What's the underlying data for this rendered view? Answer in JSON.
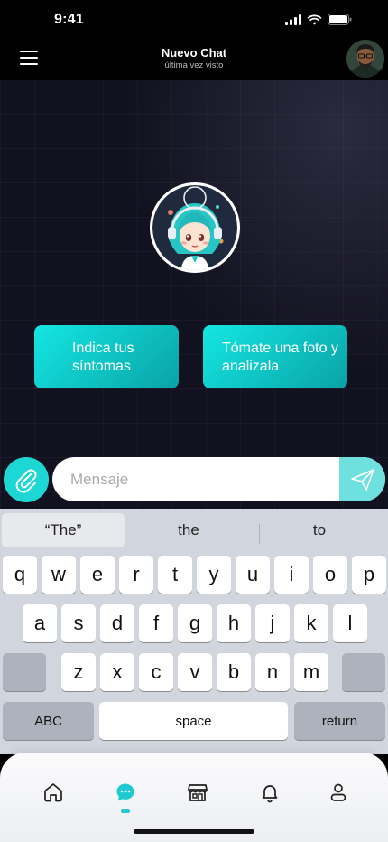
{
  "status_bar": {
    "time": "9:41"
  },
  "header": {
    "title": "Nuevo Chat",
    "subtitle": "última vez visto"
  },
  "actions": {
    "symptoms_label": "Indica tus síntomas",
    "photo_label": "Tómate una foto y analizala"
  },
  "composer": {
    "placeholder": "Mensaje"
  },
  "keyboard": {
    "suggestions": [
      "“The”",
      "the",
      "to"
    ],
    "row1": [
      "q",
      "w",
      "e",
      "r",
      "t",
      "y",
      "u",
      "i",
      "o",
      "p"
    ],
    "row2": [
      "a",
      "s",
      "d",
      "f",
      "g",
      "h",
      "j",
      "k",
      "l"
    ],
    "row3": [
      "z",
      "x",
      "c",
      "v",
      "b",
      "n",
      "m"
    ],
    "abc_label": "ABC",
    "space_label": "space",
    "return_label": "return"
  },
  "tabbar": {
    "items": [
      "home-icon",
      "chat-icon",
      "store-icon",
      "bell-icon",
      "profile-icon"
    ],
    "active": "chat-icon"
  },
  "colors": {
    "accent": "#14e6e3",
    "accent_dark": "#0aa3a6",
    "chat_bg": "#12111f",
    "send_bg": "#6ee0de"
  }
}
